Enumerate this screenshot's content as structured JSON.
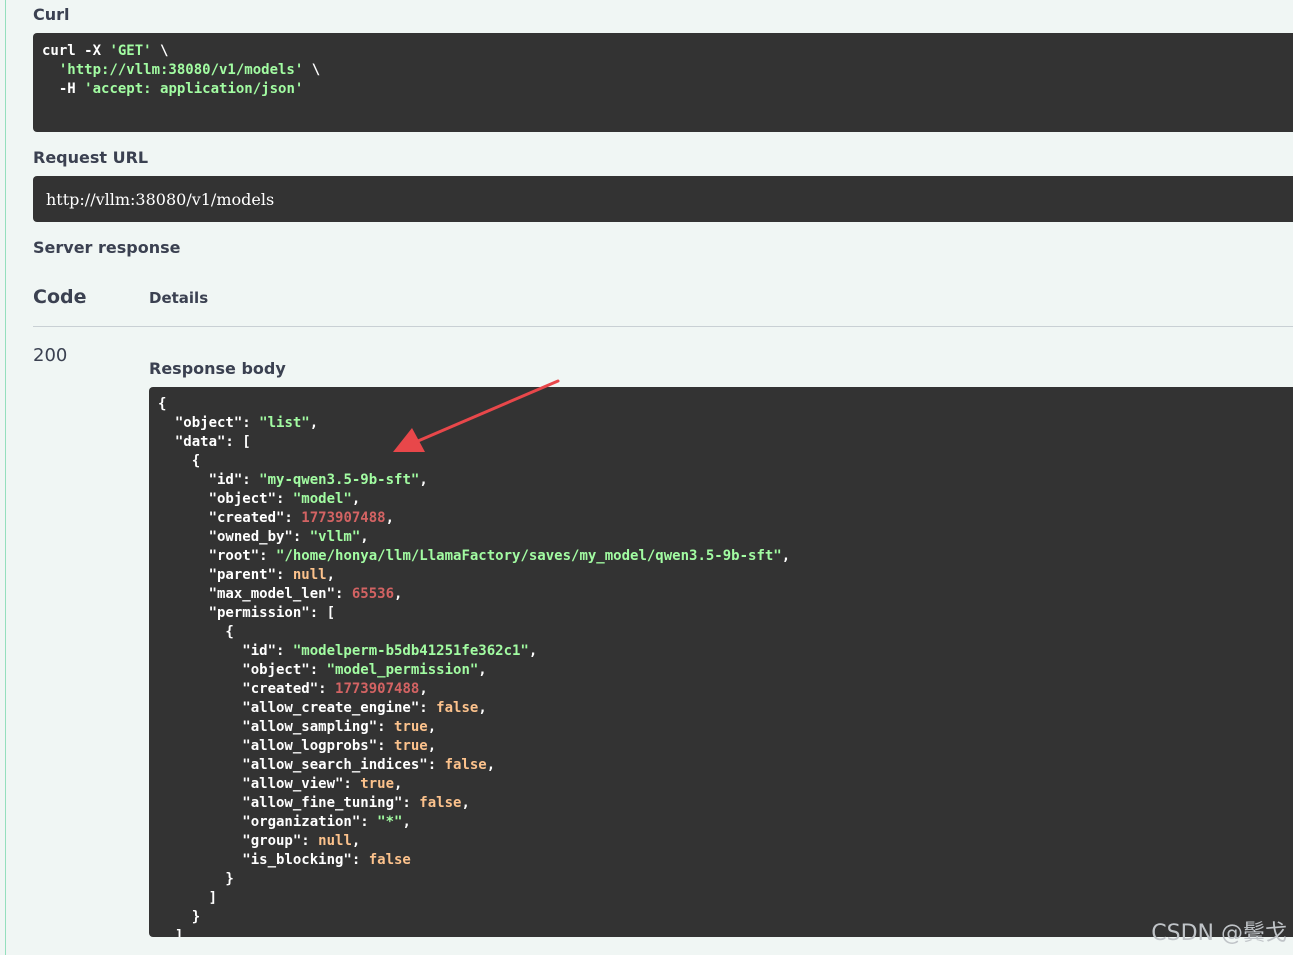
{
  "labels": {
    "curl": "Curl",
    "request_url": "Request URL",
    "server_response": "Server response",
    "code_header": "Code",
    "details_header": "Details",
    "response_body": "Response body"
  },
  "curl": {
    "line1_cmd": "curl -X ",
    "line1_method": "'GET'",
    "line1_end": " \\",
    "line2_url": "'http://vllm:38080/v1/models'",
    "line2_end": " \\",
    "line3_flag": "  -H ",
    "line3_header": "'accept: application/json'"
  },
  "request_url": "http://vllm:38080/v1/models",
  "response": {
    "status_code": "200",
    "id": "\"my-qwen3.5-9b-sft\"",
    "object_list": "\"list\"",
    "object_model": "\"model\"",
    "created": "1773907488",
    "owned_by": "\"vllm\"",
    "root": "\"/home/honya/llm/LlamaFactory/saves/my_model/qwen3.5-9b-sft\"",
    "parent": "null",
    "max_model_len": "65536",
    "perm_id": "\"modelperm-b5db41251fe362c1\"",
    "perm_object": "\"model_permission\"",
    "perm_created": "1773907488",
    "allow_create_engine": "false",
    "allow_sampling": "true",
    "allow_logprobs": "true",
    "allow_search_indices": "false",
    "allow_view": "true",
    "allow_fine_tuning": "false",
    "organization": "\"*\"",
    "group": "null",
    "is_blocking": "false"
  },
  "watermark": "CSDN @鬓戈",
  "colors": {
    "background": "#f0f6f4",
    "code_bg": "#333333",
    "string": "#a2fca2",
    "number": "#d36363",
    "boolean": "#fcc28c",
    "arrow": "#e8474a"
  }
}
